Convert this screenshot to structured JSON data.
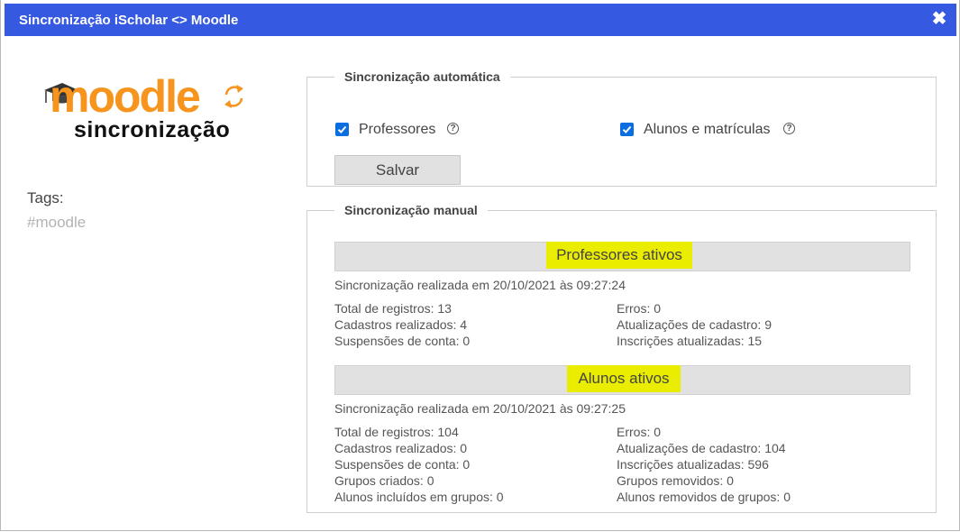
{
  "window": {
    "title": "Sincronização iScholar <> Moodle"
  },
  "logo": {
    "main": "moodle",
    "sub": "sincronização"
  },
  "tags": {
    "label": "Tags:",
    "value": "#moodle"
  },
  "auto_sync": {
    "legend": "Sincronização automática",
    "options": [
      {
        "label": "Professores",
        "checked": true
      },
      {
        "label": "Alunos e matrículas",
        "checked": true
      }
    ],
    "save_label": "Salvar"
  },
  "manual_sync": {
    "legend": "Sincronização manual",
    "teachers": {
      "title": "Professores ativos",
      "sync_text": "Sincronização realizada em 20/10/2021 às 09:27:24",
      "left": [
        "Total de registros: 13",
        "Cadastros realizados: 4",
        "Suspensões de conta: 0"
      ],
      "right": [
        "Erros: 0",
        "Atualizações de cadastro: 9",
        "Inscrições atualizadas: 15"
      ]
    },
    "students": {
      "title": "Alunos ativos",
      "sync_text": "Sincronização realizada em 20/10/2021 às 09:27:25",
      "left": [
        "Total de registros: 104",
        "Cadastros realizados: 0",
        "Suspensões de conta: 0",
        "Grupos criados: 0",
        "Alunos incluídos em grupos: 0"
      ],
      "right": [
        "Erros: 0",
        "Atualizações de cadastro: 104",
        "Inscrições atualizadas: 596",
        "Grupos removidos: 0",
        "Alunos removidos de grupos: 0"
      ]
    }
  },
  "colors": {
    "titlebar": "#3559e0",
    "checkbox": "#0b6ee0",
    "highlight": "#eaed00",
    "logo_orange": "#f7941d"
  }
}
